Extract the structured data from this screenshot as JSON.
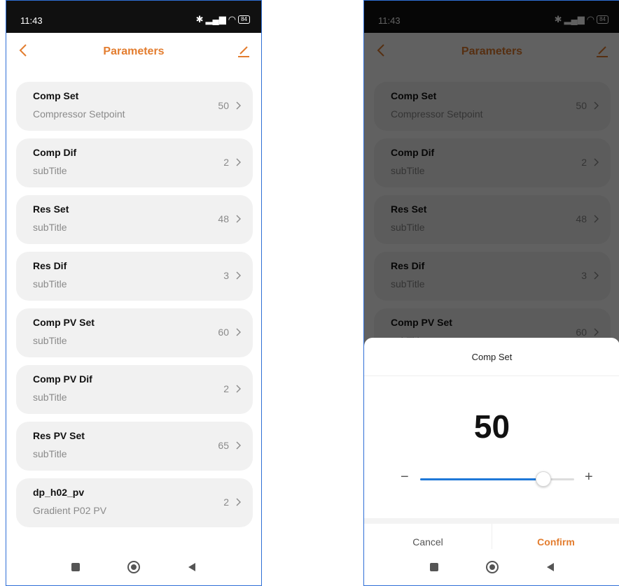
{
  "status_bar": {
    "time": "11:43",
    "battery": "84"
  },
  "header": {
    "title": "Parameters"
  },
  "params": [
    {
      "name": "Comp Set",
      "subtitle": "Compressor Setpoint",
      "value": "50"
    },
    {
      "name": "Comp Dif",
      "subtitle": "subTitle",
      "value": "2"
    },
    {
      "name": "Res Set",
      "subtitle": "subTitle",
      "value": "48"
    },
    {
      "name": "Res Dif",
      "subtitle": "subTitle",
      "value": "3"
    },
    {
      "name": "Comp PV Set",
      "subtitle": "subTitle",
      "value": "60"
    },
    {
      "name": "Comp PV Dif",
      "subtitle": "subTitle",
      "value": "2"
    },
    {
      "name": "Res PV Set",
      "subtitle": "subTitle",
      "value": "65"
    },
    {
      "name": "dp_h02_pv",
      "subtitle": "Gradient P02 PV",
      "value": "2"
    }
  ],
  "dialog": {
    "title": "Comp Set",
    "value": "50",
    "minus_label": "−",
    "plus_label": "+",
    "slider_fraction": 0.8,
    "cancel_label": "Cancel",
    "confirm_label": "Confirm"
  },
  "colors": {
    "accent": "#e37d2f",
    "slider": "#1e78d8"
  },
  "icons": {
    "back": "chevron-left-icon",
    "edit": "edit-pencil-icon",
    "nav": [
      "square-icon",
      "circle-icon",
      "triangle-back-icon"
    ]
  }
}
